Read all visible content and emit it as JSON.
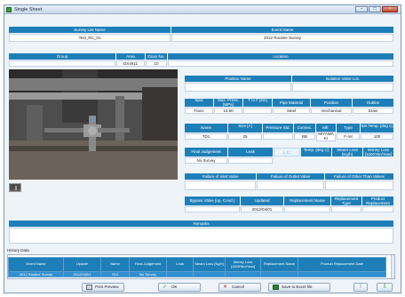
{
  "window": {
    "title": "Single Sheet",
    "min": "–",
    "max": "□",
    "close": "×"
  },
  "survey": {
    "survey_list_name_label": "Survey List Name",
    "survey_list_name": "Test_RC_01",
    "event_name_label": "Event Name",
    "event_name": "2012 Routine Survey"
  },
  "location_row": {
    "group_label": "Group",
    "area_label": "Area",
    "drain_no_label": "Drain No.",
    "location_label": "Location",
    "area": "DS4911",
    "drain_no": "10"
  },
  "valve": {
    "position_name_label": "Position Name",
    "isolation_valve_loc_label": "Isolation Valve Loc.",
    "spot_label": "Spot",
    "max_press_label": "Max. Press. [MPa]",
    "t_label": "T to F [km]",
    "pipe_material_label": "Pipe Material",
    "position_label": "Position",
    "outline_label": "Outline",
    "spot": "Trace",
    "max_press": "13.50",
    "pipe_material": "Steel",
    "position": "mechanical",
    "outline": "Drain",
    "name_label": "Name",
    "size_label": "Size [A]",
    "pressure_std_label": "Pressure Std.",
    "connection_label": "Connec.",
    "mfr_label": "Mfr.",
    "type_label": "Type",
    "set_temp_label": "Set Temp. [deg C]",
    "name": "TD1",
    "size": "25",
    "mfr": "BB",
    "type": "MIYAWA KI",
    "type2": "F-ret",
    "set_temp": "100",
    "final_judgement_label": "Final Judgement",
    "leak_label": "Leak",
    "lc_label": "L.C.",
    "temp_label": "Temp. [deg C]",
    "steam_loss_label": "Steam Loss [Kg/h]",
    "money_loss_label": "Money Loss [1000Yen/Year]",
    "final_judgement": "No Survey",
    "failure_inlet_label": "Failure of Inlet Valve",
    "failure_outlet_label": "Failure of Outlet Valve",
    "failure_other_label": "Failure of Other Than Valves",
    "bypass_label": "Bypass Valve (op. Cond.)",
    "updated_label": "Updated",
    "replacement_name_label": "Replacement Name",
    "replacement_type_label": "Replacement Type",
    "product_replacement_label": "Product Replacement",
    "updated": "2012/04/01",
    "remarks_label": "Remarks"
  },
  "history": {
    "section_label": "History Data",
    "columns": [
      "Event Name",
      "Update",
      "Name",
      "Final Judgement",
      "Leak",
      "Steam Loss [Kg/h]",
      "Money Loss [1000Yen/Year]",
      "Replacement Name",
      "Product Replacement Date"
    ],
    "rows": [
      [
        "2012 Routine Survey",
        "2012/04/01",
        "TD1",
        "No Survey",
        "",
        "",
        "",
        "",
        ""
      ]
    ]
  },
  "toolbar": {
    "print_preview": "Print Preview",
    "ok": "OK",
    "cancel": "Cancel",
    "save_excel": "Save to Excel file",
    "up_icon": "up-arrow-icon",
    "down_icon": "down-arrow-icon"
  },
  "colors": {
    "header_blue": "#1e7fb8",
    "selected_row": "#2f8fd0",
    "window_bg": "#eef3f8"
  }
}
